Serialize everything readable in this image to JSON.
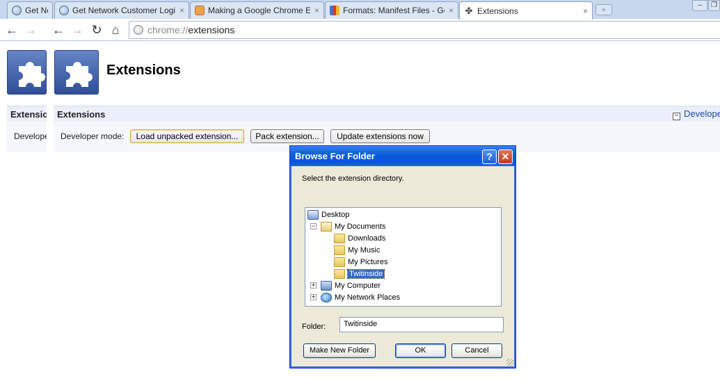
{
  "tabs": [
    {
      "label": "Get Ne",
      "icon": "globe-icon"
    },
    {
      "label": "Get Network Customer Login P",
      "icon": "globe-icon"
    },
    {
      "label": "Making a Google Chrome Exter",
      "icon": "orange-site-icon"
    },
    {
      "label": "Formats: Manifest Files - Goog",
      "icon": "google-icon"
    },
    {
      "label": "Extensions",
      "icon": "puzzle-icon",
      "active": true
    }
  ],
  "tab_close_glyph": "×",
  "newtab_glyph": "+",
  "window_controls": {
    "minimize": "–",
    "restore": "❐"
  },
  "toolbar": {
    "back": "←",
    "forward": "→",
    "reload": "↻",
    "home": "⌂",
    "url_scheme": "chrome://",
    "url_rest": "extensions"
  },
  "page": {
    "title": "Extensions",
    "section_left": "Extensio",
    "section_main": "Extensions",
    "dev_label_left": "Develope",
    "dev_label": "Developer mode:",
    "load_unpacked": "Load unpacked extension...",
    "pack": "Pack extension...",
    "update": "Update extensions now",
    "devlink_minus": "−",
    "devlink": "Develope"
  },
  "dialog": {
    "title": "Browse For Folder",
    "help": "?",
    "close": "✕",
    "prompt": "Select the extension directory.",
    "expand_glyph": "+",
    "collapse_glyph": "−",
    "tree": {
      "desktop": "Desktop",
      "my_documents": "My Documents",
      "downloads": "Downloads",
      "my_music": "My Music",
      "my_pictures": "My Pictures",
      "twitinside": "Twitinside",
      "my_computer": "My Computer",
      "my_network_places": "My Network Places"
    },
    "folder_label": "Folder:",
    "folder_value": "Twitinside",
    "make_new_folder": "Make New Folder",
    "ok": "OK",
    "cancel": "Cancel"
  },
  "colors": {
    "accent": "#316ac5",
    "titlebar": "#0a5fd8",
    "link": "#1a4bb0"
  }
}
